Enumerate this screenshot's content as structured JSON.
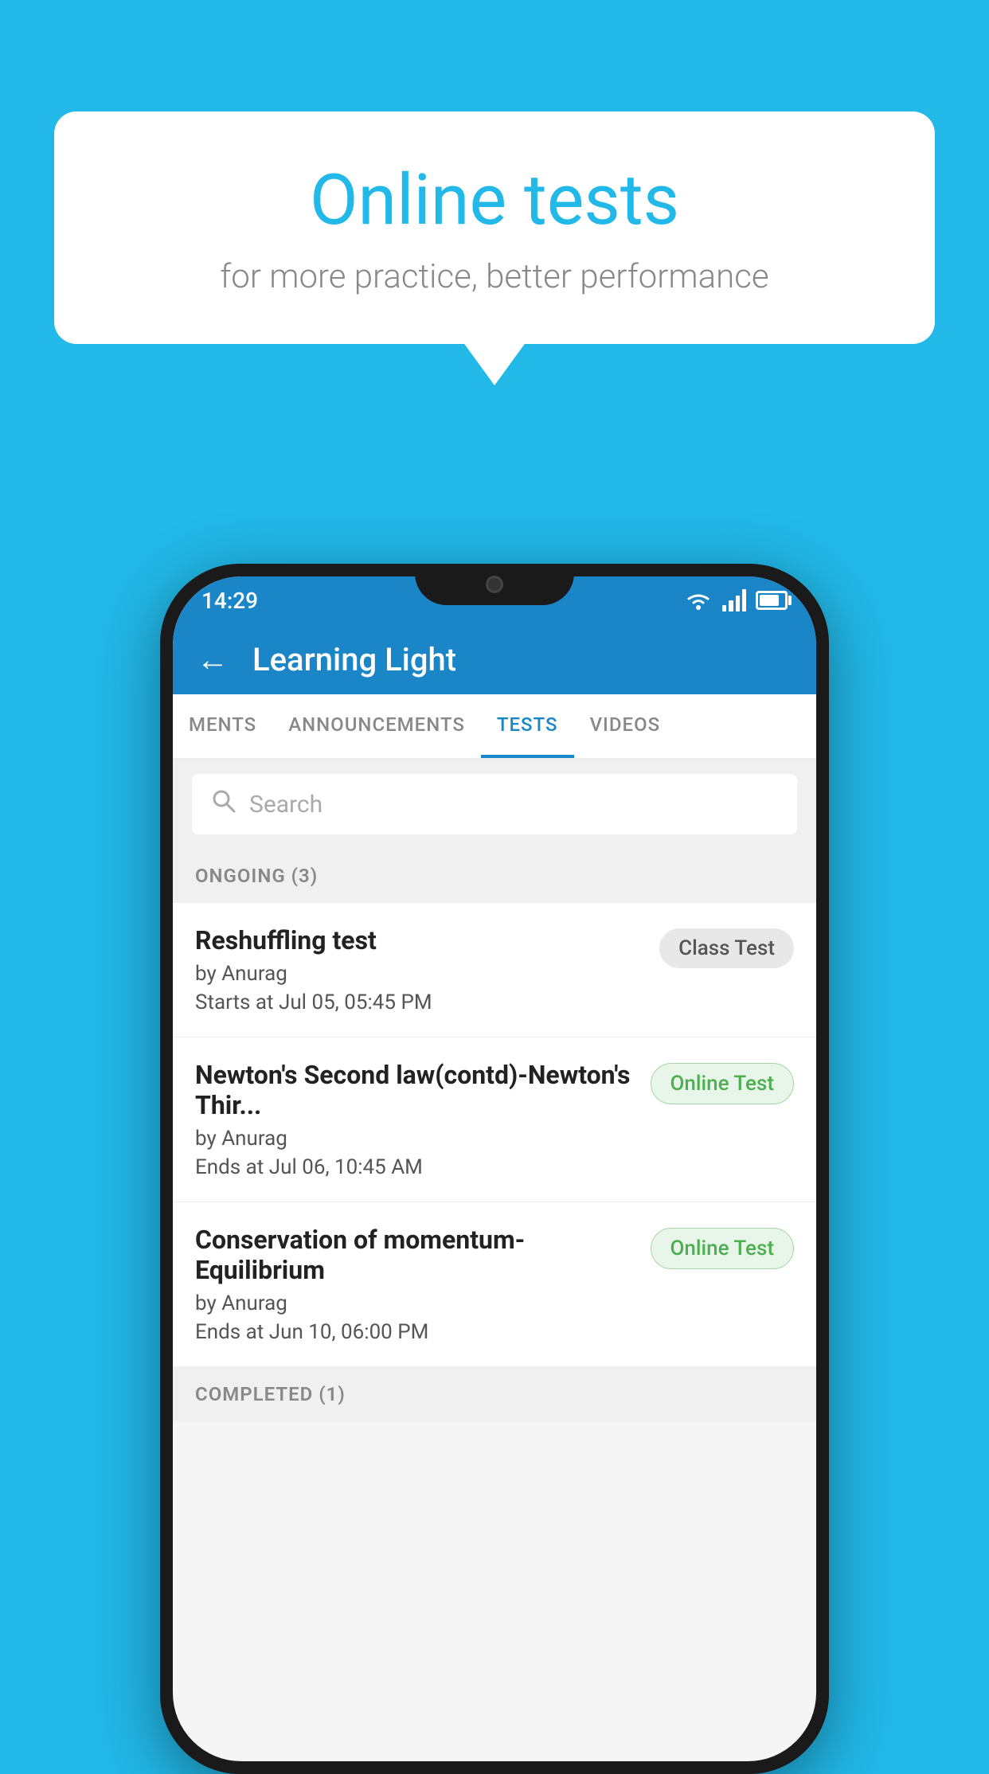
{
  "background_color": "#22b8e8",
  "bubble": {
    "title": "Online tests",
    "subtitle": "for more practice, better performance"
  },
  "phone": {
    "status_bar": {
      "time": "14:29"
    },
    "header": {
      "title": "Learning Light",
      "back_label": "←"
    },
    "tabs": [
      {
        "label": "MENTS",
        "active": false
      },
      {
        "label": "ANNOUNCEMENTS",
        "active": false
      },
      {
        "label": "TESTS",
        "active": true
      },
      {
        "label": "VIDEOS",
        "active": false
      }
    ],
    "search": {
      "placeholder": "Search"
    },
    "section_ongoing": {
      "label": "ONGOING (3)"
    },
    "tests": [
      {
        "title": "Reshuffling test",
        "author": "by Anurag",
        "date": "Starts at  Jul 05, 05:45 PM",
        "badge": "Class Test",
        "badge_type": "class"
      },
      {
        "title": "Newton's Second law(contd)-Newton's Thir...",
        "author": "by Anurag",
        "date": "Ends at  Jul 06, 10:45 AM",
        "badge": "Online Test",
        "badge_type": "online"
      },
      {
        "title": "Conservation of momentum-Equilibrium",
        "author": "by Anurag",
        "date": "Ends at  Jun 10, 06:00 PM",
        "badge": "Online Test",
        "badge_type": "online"
      }
    ],
    "section_completed": {
      "label": "COMPLETED (1)"
    }
  }
}
